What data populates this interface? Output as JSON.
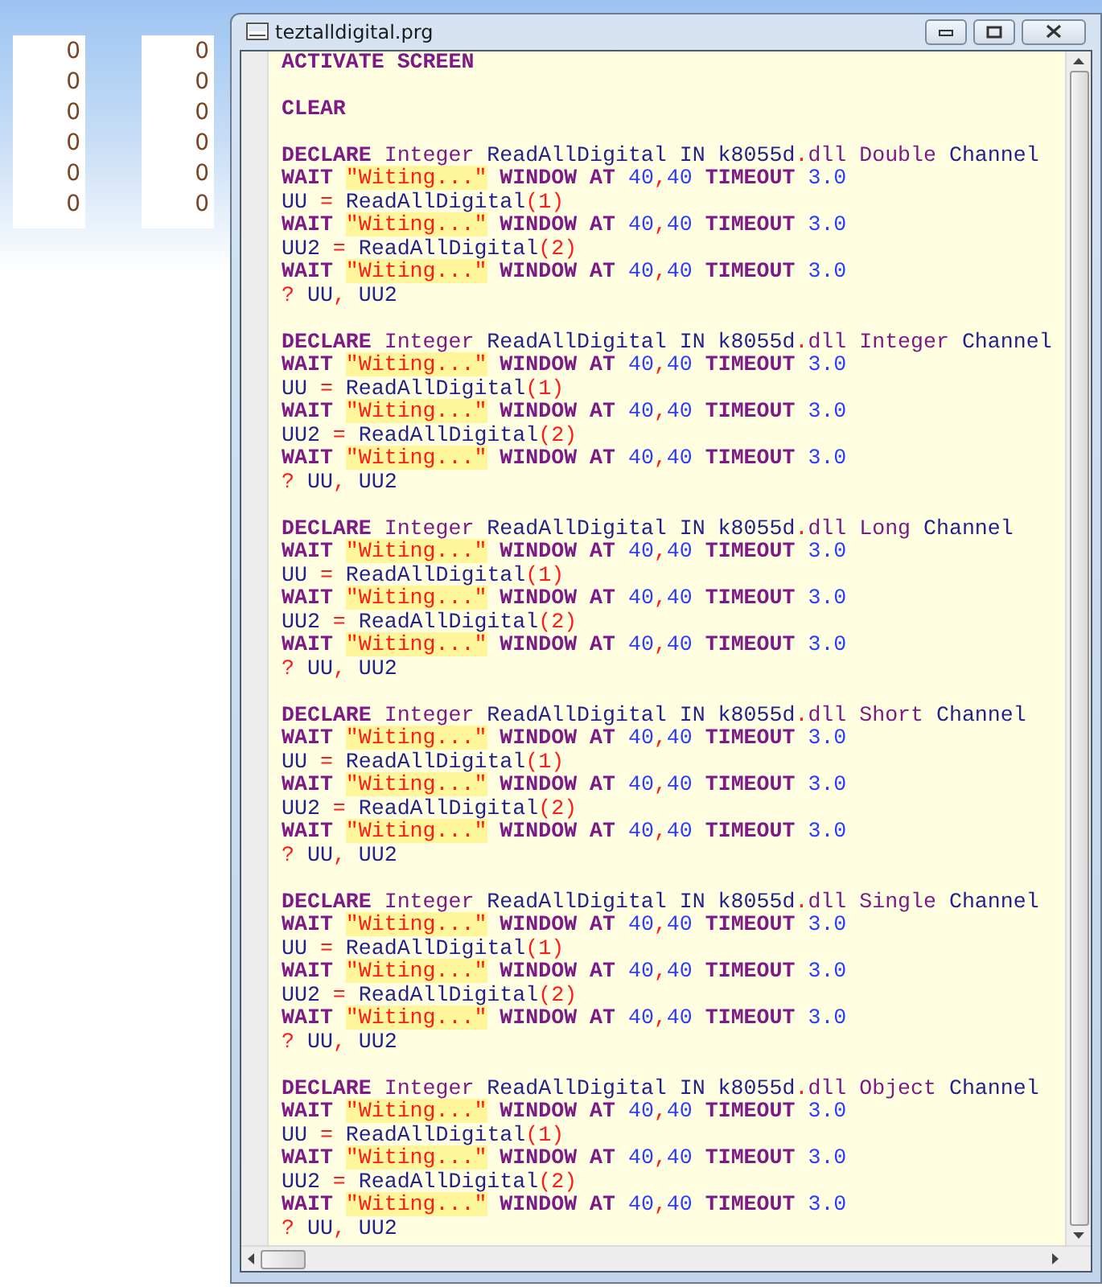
{
  "desktop": {
    "columns": [
      {
        "values": [
          "0",
          "0",
          "0",
          "0",
          "0",
          "0"
        ]
      },
      {
        "values": [
          "0",
          "0",
          "0",
          "0",
          "0",
          "0"
        ]
      }
    ]
  },
  "window": {
    "title": "teztalldigital.prg",
    "editor": {
      "blocks": [
        {
          "lines": [
            [
              {
                "kind": "kw",
                "text": "ACTIVATE SCREEN"
              }
            ]
          ]
        },
        {
          "lines": [
            [
              {
                "kind": "kw",
                "text": "CLEAR"
              }
            ]
          ]
        },
        {
          "lines": [
            [
              {
                "kind": "kw",
                "text": "DECLARE "
              },
              {
                "kind": "type",
                "text": "Integer"
              },
              {
                "kind": "id",
                "text": " ReadAllDigital IN k8055d"
              },
              {
                "kind": "op",
                "text": "."
              },
              {
                "kind": "type",
                "text": "dll Double"
              },
              {
                "kind": "id",
                "text": " Channel"
              }
            ],
            [
              {
                "kind": "kw",
                "text": "WAIT "
              },
              {
                "kind": "str",
                "text": "\"Witing...\""
              },
              {
                "kind": "kw",
                "text": " WINDOW AT "
              },
              {
                "kind": "num",
                "text": "40"
              },
              {
                "kind": "op",
                "text": ","
              },
              {
                "kind": "num",
                "text": "40"
              },
              {
                "kind": "kw",
                "text": " TIMEOUT "
              },
              {
                "kind": "num",
                "text": "3.0"
              }
            ],
            [
              {
                "kind": "id",
                "text": "UU "
              },
              {
                "kind": "op",
                "text": "="
              },
              {
                "kind": "id",
                "text": " ReadAllDigital"
              },
              {
                "kind": "op",
                "text": "(1)"
              }
            ],
            [
              {
                "kind": "kw",
                "text": "WAIT "
              },
              {
                "kind": "str",
                "text": "\"Witing...\""
              },
              {
                "kind": "kw",
                "text": " WINDOW AT "
              },
              {
                "kind": "num",
                "text": "40"
              },
              {
                "kind": "op",
                "text": ","
              },
              {
                "kind": "num",
                "text": "40"
              },
              {
                "kind": "kw",
                "text": " TIMEOUT "
              },
              {
                "kind": "num",
                "text": "3.0"
              }
            ],
            [
              {
                "kind": "id",
                "text": "UU2 "
              },
              {
                "kind": "op",
                "text": "="
              },
              {
                "kind": "id",
                "text": " ReadAllDigital"
              },
              {
                "kind": "op",
                "text": "(2)"
              }
            ],
            [
              {
                "kind": "kw",
                "text": "WAIT "
              },
              {
                "kind": "str",
                "text": "\"Witing...\""
              },
              {
                "kind": "kw",
                "text": " WINDOW AT "
              },
              {
                "kind": "num",
                "text": "40"
              },
              {
                "kind": "op",
                "text": ","
              },
              {
                "kind": "num",
                "text": "40"
              },
              {
                "kind": "kw",
                "text": " TIMEOUT "
              },
              {
                "kind": "num",
                "text": "3.0"
              }
            ],
            [
              {
                "kind": "op",
                "text": "?"
              },
              {
                "kind": "id",
                "text": " UU"
              },
              {
                "kind": "op",
                "text": ","
              },
              {
                "kind": "id",
                "text": " UU2"
              }
            ]
          ]
        },
        {
          "lines": [
            [
              {
                "kind": "kw",
                "text": "DECLARE "
              },
              {
                "kind": "type",
                "text": "Integer"
              },
              {
                "kind": "id",
                "text": " ReadAllDigital IN k8055d"
              },
              {
                "kind": "op",
                "text": "."
              },
              {
                "kind": "type",
                "text": "dll Integer"
              },
              {
                "kind": "id",
                "text": " Channel"
              }
            ],
            [
              {
                "kind": "kw",
                "text": "WAIT "
              },
              {
                "kind": "str",
                "text": "\"Witing...\""
              },
              {
                "kind": "kw",
                "text": " WINDOW AT "
              },
              {
                "kind": "num",
                "text": "40"
              },
              {
                "kind": "op",
                "text": ","
              },
              {
                "kind": "num",
                "text": "40"
              },
              {
                "kind": "kw",
                "text": " TIMEOUT "
              },
              {
                "kind": "num",
                "text": "3.0"
              }
            ],
            [
              {
                "kind": "id",
                "text": "UU "
              },
              {
                "kind": "op",
                "text": "="
              },
              {
                "kind": "id",
                "text": " ReadAllDigital"
              },
              {
                "kind": "op",
                "text": "(1)"
              }
            ],
            [
              {
                "kind": "kw",
                "text": "WAIT "
              },
              {
                "kind": "str",
                "text": "\"Witing...\""
              },
              {
                "kind": "kw",
                "text": " WINDOW AT "
              },
              {
                "kind": "num",
                "text": "40"
              },
              {
                "kind": "op",
                "text": ","
              },
              {
                "kind": "num",
                "text": "40"
              },
              {
                "kind": "kw",
                "text": " TIMEOUT "
              },
              {
                "kind": "num",
                "text": "3.0"
              }
            ],
            [
              {
                "kind": "id",
                "text": "UU2 "
              },
              {
                "kind": "op",
                "text": "="
              },
              {
                "kind": "id",
                "text": " ReadAllDigital"
              },
              {
                "kind": "op",
                "text": "(2)"
              }
            ],
            [
              {
                "kind": "kw",
                "text": "WAIT "
              },
              {
                "kind": "str",
                "text": "\"Witing...\""
              },
              {
                "kind": "kw",
                "text": " WINDOW AT "
              },
              {
                "kind": "num",
                "text": "40"
              },
              {
                "kind": "op",
                "text": ","
              },
              {
                "kind": "num",
                "text": "40"
              },
              {
                "kind": "kw",
                "text": " TIMEOUT "
              },
              {
                "kind": "num",
                "text": "3.0"
              }
            ],
            [
              {
                "kind": "op",
                "text": "?"
              },
              {
                "kind": "id",
                "text": " UU"
              },
              {
                "kind": "op",
                "text": ","
              },
              {
                "kind": "id",
                "text": " UU2"
              }
            ]
          ]
        },
        {
          "lines": [
            [
              {
                "kind": "kw",
                "text": "DECLARE "
              },
              {
                "kind": "type",
                "text": "Integer"
              },
              {
                "kind": "id",
                "text": " ReadAllDigital IN k8055d"
              },
              {
                "kind": "op",
                "text": "."
              },
              {
                "kind": "type",
                "text": "dll Long"
              },
              {
                "kind": "id",
                "text": " Channel"
              }
            ],
            [
              {
                "kind": "kw",
                "text": "WAIT "
              },
              {
                "kind": "str",
                "text": "\"Witing...\""
              },
              {
                "kind": "kw",
                "text": " WINDOW AT "
              },
              {
                "kind": "num",
                "text": "40"
              },
              {
                "kind": "op",
                "text": ","
              },
              {
                "kind": "num",
                "text": "40"
              },
              {
                "kind": "kw",
                "text": " TIMEOUT "
              },
              {
                "kind": "num",
                "text": "3.0"
              }
            ],
            [
              {
                "kind": "id",
                "text": "UU "
              },
              {
                "kind": "op",
                "text": "="
              },
              {
                "kind": "id",
                "text": " ReadAllDigital"
              },
              {
                "kind": "op",
                "text": "(1)"
              }
            ],
            [
              {
                "kind": "kw",
                "text": "WAIT "
              },
              {
                "kind": "str",
                "text": "\"Witing...\""
              },
              {
                "kind": "kw",
                "text": " WINDOW AT "
              },
              {
                "kind": "num",
                "text": "40"
              },
              {
                "kind": "op",
                "text": ","
              },
              {
                "kind": "num",
                "text": "40"
              },
              {
                "kind": "kw",
                "text": " TIMEOUT "
              },
              {
                "kind": "num",
                "text": "3.0"
              }
            ],
            [
              {
                "kind": "id",
                "text": "UU2 "
              },
              {
                "kind": "op",
                "text": "="
              },
              {
                "kind": "id",
                "text": " ReadAllDigital"
              },
              {
                "kind": "op",
                "text": "(2)"
              }
            ],
            [
              {
                "kind": "kw",
                "text": "WAIT "
              },
              {
                "kind": "str",
                "text": "\"Witing...\""
              },
              {
                "kind": "kw",
                "text": " WINDOW AT "
              },
              {
                "kind": "num",
                "text": "40"
              },
              {
                "kind": "op",
                "text": ","
              },
              {
                "kind": "num",
                "text": "40"
              },
              {
                "kind": "kw",
                "text": " TIMEOUT "
              },
              {
                "kind": "num",
                "text": "3.0"
              }
            ],
            [
              {
                "kind": "op",
                "text": "?"
              },
              {
                "kind": "id",
                "text": " UU"
              },
              {
                "kind": "op",
                "text": ","
              },
              {
                "kind": "id",
                "text": " UU2"
              }
            ]
          ]
        },
        {
          "lines": [
            [
              {
                "kind": "kw",
                "text": "DECLARE "
              },
              {
                "kind": "type",
                "text": "Integer"
              },
              {
                "kind": "id",
                "text": " ReadAllDigital IN k8055d"
              },
              {
                "kind": "op",
                "text": "."
              },
              {
                "kind": "type",
                "text": "dll Short"
              },
              {
                "kind": "id",
                "text": " Channel"
              }
            ],
            [
              {
                "kind": "kw",
                "text": "WAIT "
              },
              {
                "kind": "str",
                "text": "\"Witing...\""
              },
              {
                "kind": "kw",
                "text": " WINDOW AT "
              },
              {
                "kind": "num",
                "text": "40"
              },
              {
                "kind": "op",
                "text": ","
              },
              {
                "kind": "num",
                "text": "40"
              },
              {
                "kind": "kw",
                "text": " TIMEOUT "
              },
              {
                "kind": "num",
                "text": "3.0"
              }
            ],
            [
              {
                "kind": "id",
                "text": "UU "
              },
              {
                "kind": "op",
                "text": "="
              },
              {
                "kind": "id",
                "text": " ReadAllDigital"
              },
              {
                "kind": "op",
                "text": "(1)"
              }
            ],
            [
              {
                "kind": "kw",
                "text": "WAIT "
              },
              {
                "kind": "str",
                "text": "\"Witing...\""
              },
              {
                "kind": "kw",
                "text": " WINDOW AT "
              },
              {
                "kind": "num",
                "text": "40"
              },
              {
                "kind": "op",
                "text": ","
              },
              {
                "kind": "num",
                "text": "40"
              },
              {
                "kind": "kw",
                "text": " TIMEOUT "
              },
              {
                "kind": "num",
                "text": "3.0"
              }
            ],
            [
              {
                "kind": "id",
                "text": "UU2 "
              },
              {
                "kind": "op",
                "text": "="
              },
              {
                "kind": "id",
                "text": " ReadAllDigital"
              },
              {
                "kind": "op",
                "text": "(2)"
              }
            ],
            [
              {
                "kind": "kw",
                "text": "WAIT "
              },
              {
                "kind": "str",
                "text": "\"Witing...\""
              },
              {
                "kind": "kw",
                "text": " WINDOW AT "
              },
              {
                "kind": "num",
                "text": "40"
              },
              {
                "kind": "op",
                "text": ","
              },
              {
                "kind": "num",
                "text": "40"
              },
              {
                "kind": "kw",
                "text": " TIMEOUT "
              },
              {
                "kind": "num",
                "text": "3.0"
              }
            ],
            [
              {
                "kind": "op",
                "text": "?"
              },
              {
                "kind": "id",
                "text": " UU"
              },
              {
                "kind": "op",
                "text": ","
              },
              {
                "kind": "id",
                "text": " UU2"
              }
            ]
          ]
        },
        {
          "lines": [
            [
              {
                "kind": "kw",
                "text": "DECLARE "
              },
              {
                "kind": "type",
                "text": "Integer"
              },
              {
                "kind": "id",
                "text": " ReadAllDigital IN k8055d"
              },
              {
                "kind": "op",
                "text": "."
              },
              {
                "kind": "type",
                "text": "dll Single"
              },
              {
                "kind": "id",
                "text": " Channel"
              }
            ],
            [
              {
                "kind": "kw",
                "text": "WAIT "
              },
              {
                "kind": "str",
                "text": "\"Witing...\""
              },
              {
                "kind": "kw",
                "text": " WINDOW AT "
              },
              {
                "kind": "num",
                "text": "40"
              },
              {
                "kind": "op",
                "text": ","
              },
              {
                "kind": "num",
                "text": "40"
              },
              {
                "kind": "kw",
                "text": " TIMEOUT "
              },
              {
                "kind": "num",
                "text": "3.0"
              }
            ],
            [
              {
                "kind": "id",
                "text": "UU "
              },
              {
                "kind": "op",
                "text": "="
              },
              {
                "kind": "id",
                "text": " ReadAllDigital"
              },
              {
                "kind": "op",
                "text": "(1)"
              }
            ],
            [
              {
                "kind": "kw",
                "text": "WAIT "
              },
              {
                "kind": "str",
                "text": "\"Witing...\""
              },
              {
                "kind": "kw",
                "text": " WINDOW AT "
              },
              {
                "kind": "num",
                "text": "40"
              },
              {
                "kind": "op",
                "text": ","
              },
              {
                "kind": "num",
                "text": "40"
              },
              {
                "kind": "kw",
                "text": " TIMEOUT "
              },
              {
                "kind": "num",
                "text": "3.0"
              }
            ],
            [
              {
                "kind": "id",
                "text": "UU2 "
              },
              {
                "kind": "op",
                "text": "="
              },
              {
                "kind": "id",
                "text": " ReadAllDigital"
              },
              {
                "kind": "op",
                "text": "(2)"
              }
            ],
            [
              {
                "kind": "kw",
                "text": "WAIT "
              },
              {
                "kind": "str",
                "text": "\"Witing...\""
              },
              {
                "kind": "kw",
                "text": " WINDOW AT "
              },
              {
                "kind": "num",
                "text": "40"
              },
              {
                "kind": "op",
                "text": ","
              },
              {
                "kind": "num",
                "text": "40"
              },
              {
                "kind": "kw",
                "text": " TIMEOUT "
              },
              {
                "kind": "num",
                "text": "3.0"
              }
            ],
            [
              {
                "kind": "op",
                "text": "?"
              },
              {
                "kind": "id",
                "text": " UU"
              },
              {
                "kind": "op",
                "text": ","
              },
              {
                "kind": "id",
                "text": " UU2"
              }
            ]
          ]
        },
        {
          "lines": [
            [
              {
                "kind": "kw",
                "text": "DECLARE "
              },
              {
                "kind": "type",
                "text": "Integer"
              },
              {
                "kind": "id",
                "text": " ReadAllDigital IN k8055d"
              },
              {
                "kind": "op",
                "text": "."
              },
              {
                "kind": "type",
                "text": "dll Object"
              },
              {
                "kind": "id",
                "text": " Channel"
              }
            ],
            [
              {
                "kind": "kw",
                "text": "WAIT "
              },
              {
                "kind": "str",
                "text": "\"Witing...\""
              },
              {
                "kind": "kw",
                "text": " WINDOW AT "
              },
              {
                "kind": "num",
                "text": "40"
              },
              {
                "kind": "op",
                "text": ","
              },
              {
                "kind": "num",
                "text": "40"
              },
              {
                "kind": "kw",
                "text": " TIMEOUT "
              },
              {
                "kind": "num",
                "text": "3.0"
              }
            ],
            [
              {
                "kind": "id",
                "text": "UU "
              },
              {
                "kind": "op",
                "text": "="
              },
              {
                "kind": "id",
                "text": " ReadAllDigital"
              },
              {
                "kind": "op",
                "text": "(1)"
              }
            ],
            [
              {
                "kind": "kw",
                "text": "WAIT "
              },
              {
                "kind": "str",
                "text": "\"Witing...\""
              },
              {
                "kind": "kw",
                "text": " WINDOW AT "
              },
              {
                "kind": "num",
                "text": "40"
              },
              {
                "kind": "op",
                "text": ","
              },
              {
                "kind": "num",
                "text": "40"
              },
              {
                "kind": "kw",
                "text": " TIMEOUT "
              },
              {
                "kind": "num",
                "text": "3.0"
              }
            ],
            [
              {
                "kind": "id",
                "text": "UU2 "
              },
              {
                "kind": "op",
                "text": "="
              },
              {
                "kind": "id",
                "text": " ReadAllDigital"
              },
              {
                "kind": "op",
                "text": "(2)"
              }
            ],
            [
              {
                "kind": "kw",
                "text": "WAIT "
              },
              {
                "kind": "str",
                "text": "\"Witing...\""
              },
              {
                "kind": "kw",
                "text": " WINDOW AT "
              },
              {
                "kind": "num",
                "text": "40"
              },
              {
                "kind": "op",
                "text": ","
              },
              {
                "kind": "num",
                "text": "40"
              },
              {
                "kind": "kw",
                "text": " TIMEOUT "
              },
              {
                "kind": "num",
                "text": "3.0"
              }
            ],
            [
              {
                "kind": "op",
                "text": "?"
              },
              {
                "kind": "id",
                "text": " UU"
              },
              {
                "kind": "op",
                "text": ","
              },
              {
                "kind": "id",
                "text": " UU2"
              }
            ]
          ]
        }
      ]
    }
  }
}
